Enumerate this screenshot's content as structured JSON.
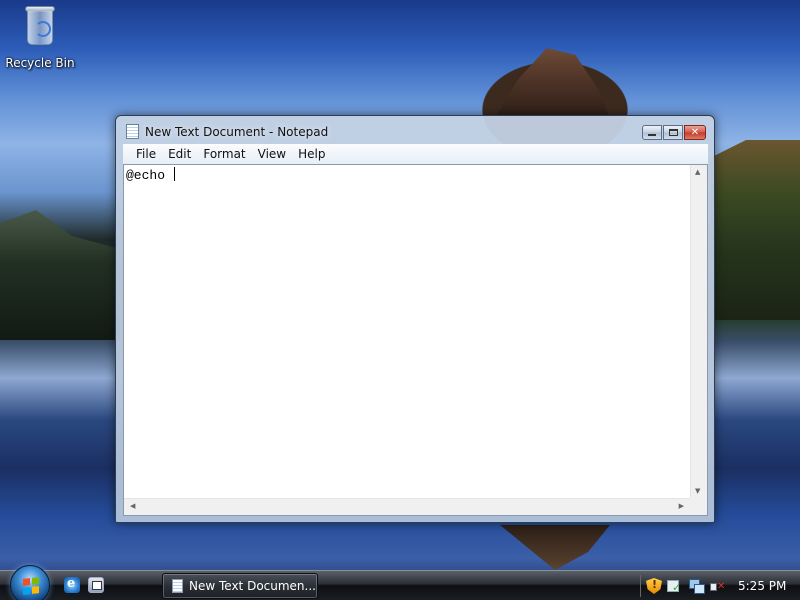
{
  "desktop": {
    "icons": [
      {
        "label": "Recycle Bin",
        "icon": "recycle-bin-icon"
      }
    ]
  },
  "window": {
    "title": "New Text Document - Notepad",
    "app_icon": "notepad-icon",
    "controls": {
      "minimize": "minimize-icon",
      "maximize": "maximize-icon",
      "close": "✕"
    },
    "menu": [
      "File",
      "Edit",
      "Format",
      "View",
      "Help"
    ],
    "content": "@echo "
  },
  "taskbar": {
    "start": "windows-logo-icon",
    "quick_launch": [
      "internet-explorer-icon",
      "switch-windows-icon"
    ],
    "tasks": [
      {
        "label": "New Text Documen...",
        "icon": "notepad-icon"
      }
    ],
    "tray_icons": [
      "security-shield-icon",
      "windows-update-icon",
      "network-icon",
      "volume-muted-icon"
    ],
    "clock": "5:25 PM"
  },
  "colors": {
    "taskbar_bg": "#1a1d22",
    "window_frame": "#b2c4da",
    "close_button": "#c03a2a"
  }
}
